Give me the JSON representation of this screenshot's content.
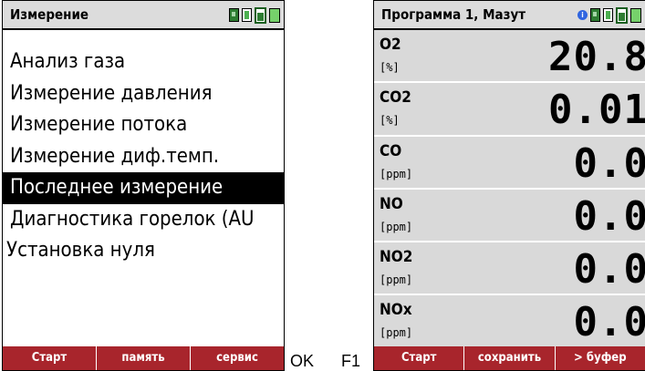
{
  "left": {
    "title": "Измерение",
    "menu": [
      "Анализ газа",
      "Измерение давления",
      "Измерение потока",
      "Измерение диф.темп.",
      "Последнее измерение",
      "Диагностика горелок (AU",
      "Установка нуля"
    ],
    "selected_index": 4,
    "softkeys": [
      "Старт",
      "память",
      "сервис"
    ]
  },
  "between_labels": {
    "ok": "OK",
    "f1": "F1"
  },
  "right": {
    "title": "Программа 1, Мазут",
    "rows": [
      {
        "name": "O2",
        "unit": "[%]",
        "value": "20.8"
      },
      {
        "name": "CO2",
        "unit": "[%]",
        "value": "0.01"
      },
      {
        "name": "CO",
        "unit": "[ppm]",
        "value": "0.0"
      },
      {
        "name": "NO",
        "unit": "[ppm]",
        "value": "0.0"
      },
      {
        "name": "NO2",
        "unit": "[ppm]",
        "value": "0.0"
      },
      {
        "name": "NOx",
        "unit": "[ppm]",
        "value": "0.0"
      }
    ],
    "softkeys": [
      "Старт",
      "сохранить",
      "> буфер"
    ]
  },
  "colors": {
    "softkey_bg": "#a8252c",
    "titlebar_bg": "#dcdcdc",
    "readout_bg": "#d9d9d9"
  }
}
